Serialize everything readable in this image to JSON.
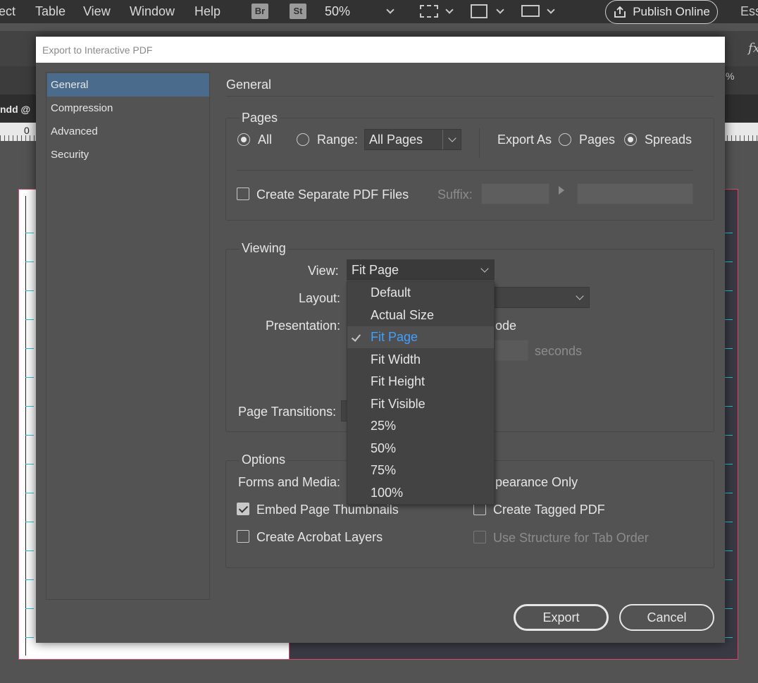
{
  "menubar": {
    "items": [
      "ect",
      "Table",
      "View",
      "Window",
      "Help"
    ],
    "bridge_icon": "Br",
    "stock_icon": "St",
    "zoom": "50%",
    "publish_label": "Publish Online",
    "workspace": "Ess"
  },
  "document": {
    "tab_text": "ndd @",
    "ruler_zero": "0",
    "fx_label": "fx",
    "percent_label": "%"
  },
  "dialog": {
    "title": "Export to Interactive PDF",
    "sidebar": [
      "General",
      "Compression",
      "Advanced",
      "Security"
    ],
    "section_title": "General",
    "pages": {
      "group_label": "Pages",
      "all_label": "All",
      "range_label": "Range:",
      "range_value": "All Pages",
      "export_as_label": "Export As",
      "pages_label": "Pages",
      "spreads_label": "Spreads",
      "separate_label": "Create Separate PDF Files",
      "suffix_label": "Suffix:"
    },
    "viewing": {
      "group_label": "Viewing",
      "view_label": "View:",
      "view_value": "Fit Page",
      "layout_label": "Layout:",
      "presentation_label": "Presentation:",
      "mode_fragment": "ode",
      "seconds_label": "seconds",
      "transitions_label": "Page Transitions:"
    },
    "options": {
      "group_label": "Options",
      "forms_label": "Forms and Media:",
      "appearance_fragment": "pearance Only",
      "thumbnails_label": "Embed Page Thumbnails",
      "tagged_label": "Create Tagged PDF",
      "layers_label": "Create Acrobat Layers",
      "structure_label": "Use Structure for Tab Order"
    },
    "export_button": "Export",
    "cancel_button": "Cancel"
  },
  "view_dropdown": {
    "items": [
      "Default",
      "Actual Size",
      "Fit Page",
      "Fit Width",
      "Fit Height",
      "Fit Visible",
      "25%",
      "50%",
      "75%",
      "100%"
    ],
    "selected": "Fit Page"
  },
  "colors": {
    "selection": "#4b6b8c",
    "menu_highlight": "#3fa0ff",
    "bleed_guide": "#d9476b",
    "margin_guide": "#27c4d4"
  },
  "icons": [
    "share-icon",
    "checkmark-icon",
    "chevron-down-icon",
    "triangle-right-icon",
    "frame-icon",
    "view-mode-icon",
    "layout-icon"
  ]
}
